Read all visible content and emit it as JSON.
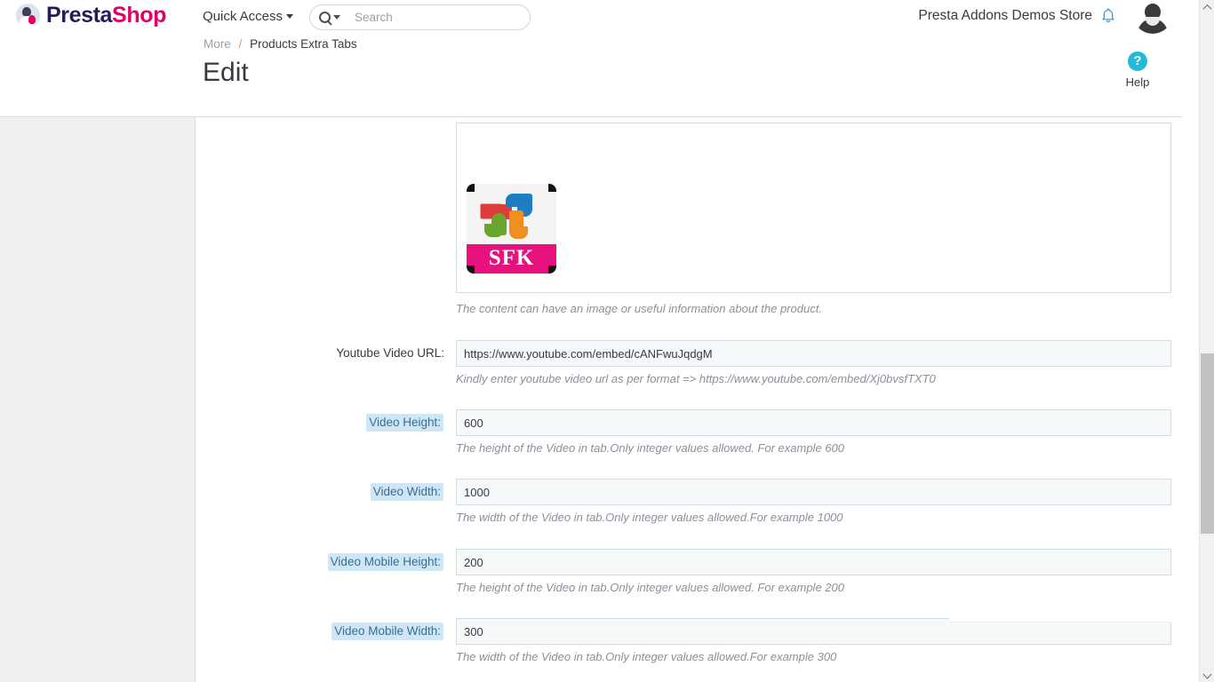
{
  "header": {
    "logo": {
      "part_a": "Presta",
      "part_b": "Shop",
      "icon": "prestashop-mascot-icon"
    },
    "quick_access": "Quick Access",
    "search": {
      "placeholder": "Search",
      "value": "",
      "icon": "search-icon"
    },
    "shop_name": "Presta Addons Demos Store",
    "notifications_icon": "bell-icon",
    "avatar_icon": "user-avatar-icon",
    "help": {
      "glyph": "?",
      "label": "Help"
    }
  },
  "breadcrumb": {
    "parent": "More",
    "separator": "/",
    "current": "Products Extra Tabs"
  },
  "page": {
    "title": "Edit"
  },
  "editor": {
    "image_alt": "SFK",
    "image_band_text": "SFK",
    "hint": "The content can have an image or useful information about the product."
  },
  "fields": [
    {
      "label": "Youtube Video URL:",
      "highlighted": false,
      "value": "https://www.youtube.com/embed/cANFwuJqdgM",
      "hint": "Kindly enter youtube video url as per format => https://www.youtube.com/embed/Xj0bvsfTXT0"
    },
    {
      "label": "Video Height:",
      "highlighted": true,
      "value": "600",
      "hint": "The height of the Video in tab.Only integer values allowed. For example 600"
    },
    {
      "label": "Video Width:",
      "highlighted": true,
      "value": "1000",
      "hint": "The width of the Video in tab.Only integer values allowed.For example 1000"
    },
    {
      "label": "Video Mobile Height:",
      "highlighted": true,
      "value": "200",
      "hint": "The height of the Video in tab.Only integer values allowed. For example 200"
    },
    {
      "label": "Video Mobile Width:",
      "highlighted": true,
      "value": "300",
      "hint": "The width of the Video in tab.Only integer values allowed.For example 300"
    }
  ],
  "scrollbar": {
    "up_icon": "chevron-up-icon",
    "down_icon": "chevron-down-icon"
  },
  "colors": {
    "brand_dark": "#251b5b",
    "brand_pink": "#df0067",
    "help_blue": "#25b9d7",
    "highlight_bg": "#cfe6f7",
    "input_bg": "#f6f9fa",
    "input_border": "#cfdde6",
    "rail_bg": "#eef0f2"
  }
}
